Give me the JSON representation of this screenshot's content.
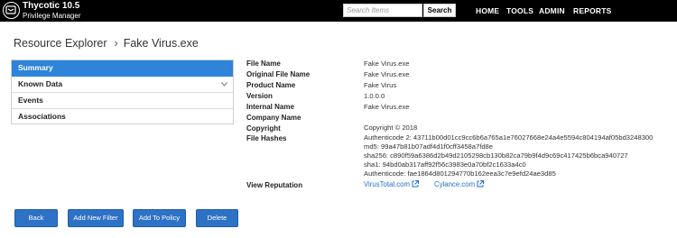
{
  "brand": {
    "name": "Thycotic 10.5",
    "subtitle": "Privilege Manager"
  },
  "search": {
    "placeholder": "Search Items",
    "button_label": "Search"
  },
  "nav": {
    "home": "HOME",
    "tools": "TOOLS",
    "admin": "ADMIN",
    "reports": "REPORTS"
  },
  "breadcrumb": {
    "root": "Resource Explorer",
    "separator": "›",
    "current": "Fake Virus.exe"
  },
  "sidebar": {
    "items": [
      {
        "label": "Summary",
        "active": true
      },
      {
        "label": "Known Data",
        "active": false,
        "expandable": true
      },
      {
        "label": "Events",
        "active": false
      },
      {
        "label": "Associations",
        "active": false
      }
    ]
  },
  "details": {
    "file_name": {
      "label": "File Name",
      "value": "Fake Virus.exe"
    },
    "original_file_name": {
      "label": "Original File Name",
      "value": "Fake Virus.exe"
    },
    "product_name": {
      "label": "Product Name",
      "value": "Fake Virus"
    },
    "version": {
      "label": "Version",
      "value": "1.0.0.0"
    },
    "internal_name": {
      "label": "Internal Name",
      "value": "Fake Virus.exe"
    },
    "company_name": {
      "label": "Company Name",
      "value": ""
    },
    "copyright": {
      "label": "Copyright",
      "value": "Copyright © 2018"
    },
    "file_hashes": {
      "label": "File Hashes",
      "values": [
        "Authenticode 2: 43711b00d01cc9cc6b6a765a1e76027668e24a4e5594c804194af05bd3248300",
        "md5: 99a47b81b07adf4d1f0cff3458a7fd8e",
        "sha256: c890f59a6386d2b49d2105298cb130b82ca79b9f4d9c69c417425b6bca940727",
        "sha1: 94bd0ab317aff92f56c3983e0a70bf2c1633a4c0",
        "Authenticode: fae1864d801294770b162eea3c7e9efd24ae3d85"
      ]
    },
    "view_reputation": {
      "label": "View Reputation",
      "links": [
        "VirusTotal.com",
        "Cylance.com"
      ]
    }
  },
  "buttons": {
    "back": "Back",
    "add_new_filter": "Add New Filter",
    "add_to_policy": "Add To Policy",
    "delete": "Delete"
  },
  "colors": {
    "topbar": "#000000",
    "accent": "#2d84d8",
    "button": "#2d72c4",
    "link": "#2070c8"
  },
  "icons": {
    "logo": "shield-logo-icon",
    "chevron": "chevron-down-icon",
    "external": "external-link-icon"
  }
}
